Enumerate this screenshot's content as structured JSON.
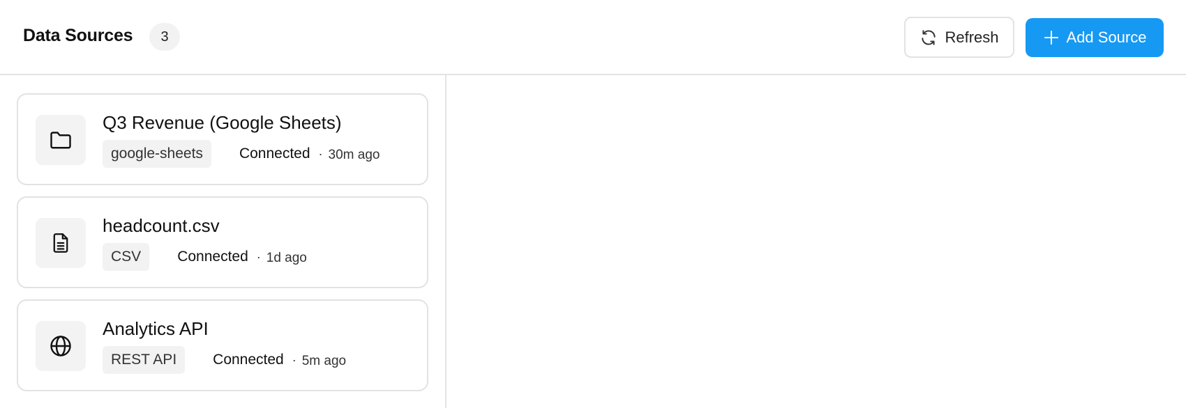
{
  "header": {
    "title": "Data Sources",
    "count": "3",
    "refresh_label": "Refresh",
    "refresh_icon": "refresh-icon",
    "add_label": "Add Source",
    "add_icon": "plus-icon",
    "accent_color": "#1699f3"
  },
  "sources": [
    {
      "name": "Q3 Revenue (Google Sheets)",
      "type": "google-sheets",
      "status": "Connected",
      "separator": "·",
      "updated": "30m ago",
      "icon": "folder-icon"
    },
    {
      "name": "headcount.csv",
      "type": "CSV",
      "status": "Connected",
      "separator": "·",
      "updated": "1d ago",
      "icon": "file-text-icon"
    },
    {
      "name": "Analytics API",
      "type": "REST API",
      "status": "Connected",
      "separator": "·",
      "updated": "5m ago",
      "icon": "globe-icon"
    }
  ]
}
